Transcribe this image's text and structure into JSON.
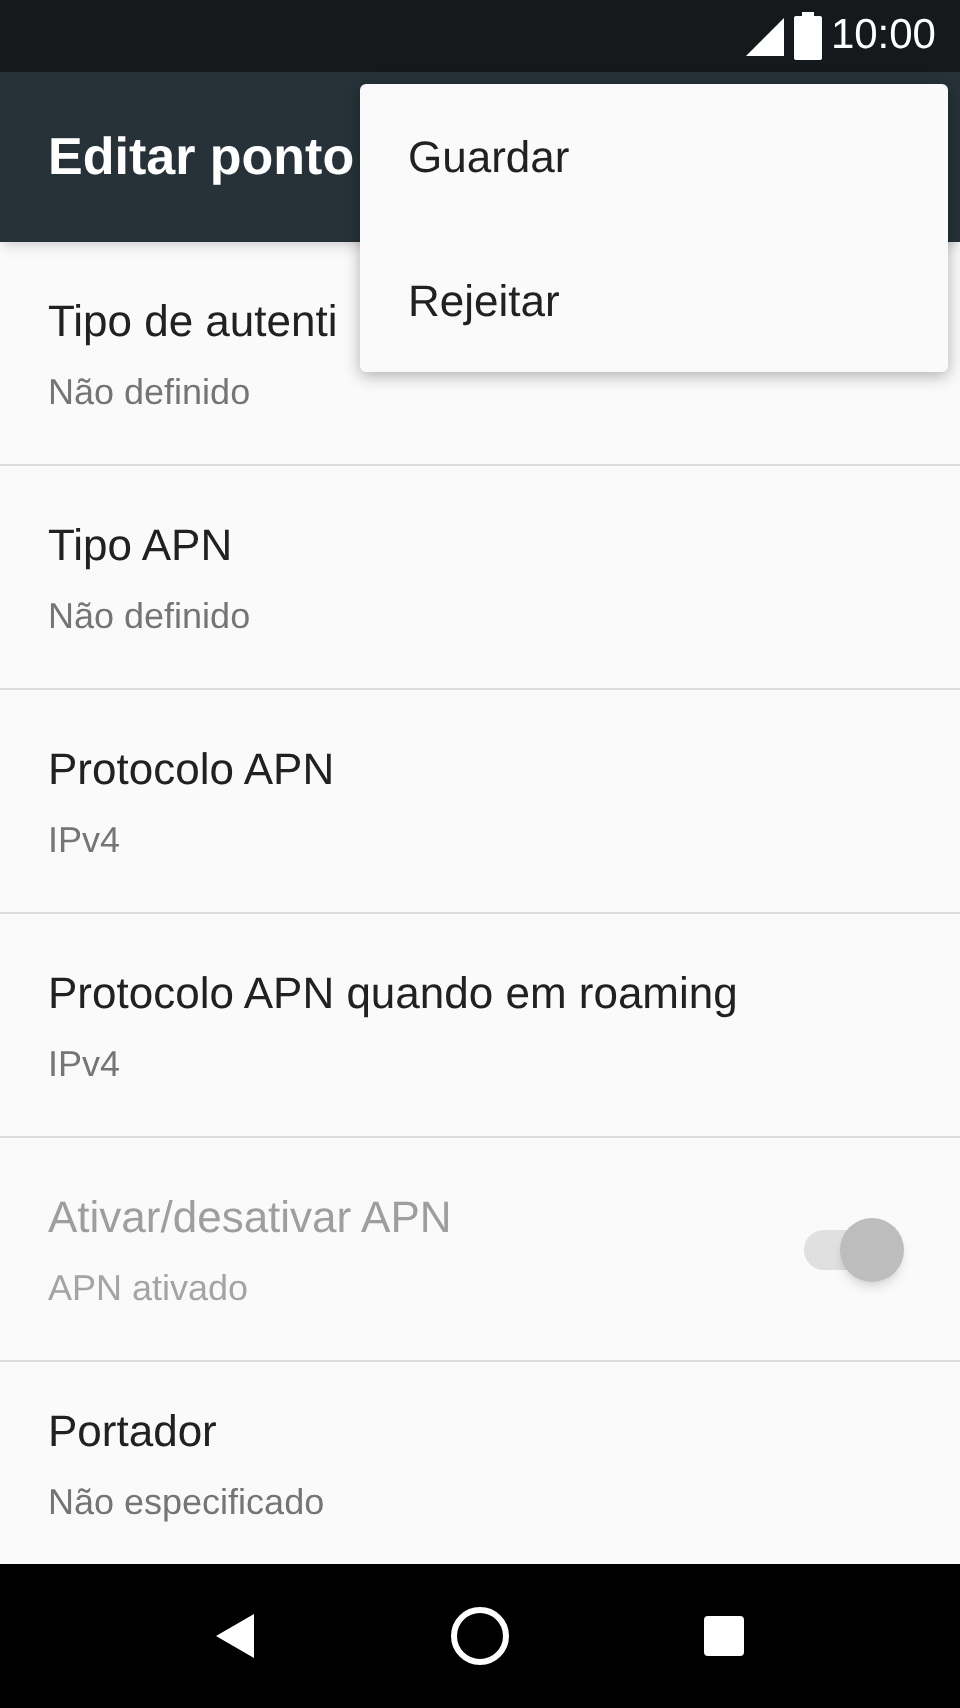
{
  "status_bar": {
    "time": "10:00"
  },
  "toolbar": {
    "title": "Editar ponto"
  },
  "overflow_menu": {
    "items": [
      {
        "label": "Guardar"
      },
      {
        "label": "Rejeitar"
      }
    ]
  },
  "settings": [
    {
      "kind": "text",
      "title": "Tipo de autenti",
      "summary": "Não definido",
      "disabled": false
    },
    {
      "kind": "text",
      "title": "Tipo APN",
      "summary": "Não definido",
      "disabled": false
    },
    {
      "kind": "text",
      "title": "Protocolo APN",
      "summary": "IPv4",
      "disabled": false
    },
    {
      "kind": "text",
      "title": "Protocolo APN quando em roaming",
      "summary": "IPv4",
      "disabled": false
    },
    {
      "kind": "toggle",
      "title": "Ativar/desativar APN",
      "summary": "APN ativado",
      "disabled": true,
      "on": true
    },
    {
      "kind": "text",
      "title": "Portador",
      "summary": "Não especificado",
      "disabled": false
    }
  ]
}
